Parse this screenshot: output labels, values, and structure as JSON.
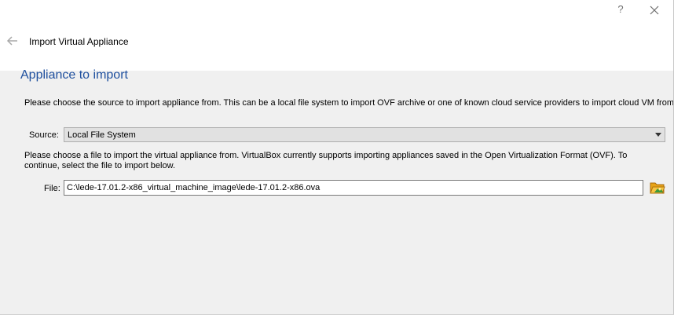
{
  "window": {
    "help_glyph": "?",
    "title": "Import Virtual Appliance"
  },
  "page": {
    "heading": "Appliance to import",
    "source_hint": "Please choose the source to import appliance from. This can be a local file system to import OVF archive or one of known cloud service providers to import cloud VM from.",
    "source_label": "Source:",
    "source_value": "Local File System",
    "file_hint": "Please choose a file to import the virtual appliance from. VirtualBox currently supports importing appliances saved in the Open Virtualization Format (OVF). To continue, select the file to import below.",
    "file_label": "File:",
    "file_value": "C:\\lede-17.01.2-x86_virtual_machine_image\\lede-17.01.2-x86.ova"
  },
  "icons": {
    "help": "question-mark-icon",
    "close": "close-icon",
    "back": "back-arrow-icon",
    "dropdown": "chevron-down-icon",
    "browse": "folder-open-icon"
  },
  "colors": {
    "heading": "#1e4f9e",
    "content_bg": "#f0f0f0",
    "header_bg": "#ffffff"
  }
}
